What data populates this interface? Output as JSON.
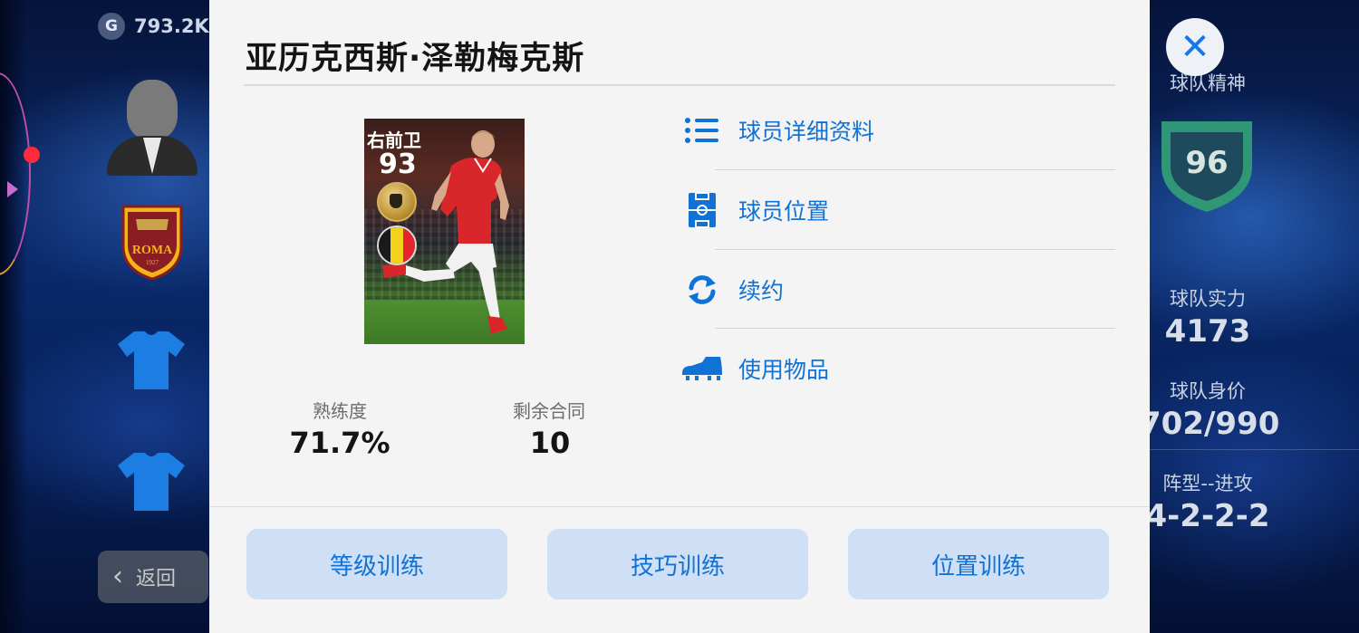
{
  "hud": {
    "coin_symbol": "G",
    "coins": "793.2K",
    "back_label": "返回"
  },
  "team_panel": {
    "spirit_label": "球队精神",
    "spirit_value": "96",
    "strength_label": "球队实力",
    "strength_value": "4173",
    "value_label": "球队身价",
    "value_value": "702/990",
    "formation_label": "阵型--进攻",
    "formation_value": "4-2-2-2"
  },
  "club_badge": {
    "name": "ROMA",
    "year": "1927"
  },
  "modal": {
    "player_name": "亚历克西斯·泽勒梅克斯",
    "card": {
      "position": "右前卫",
      "rating": "93",
      "flag_colors": [
        "#1a1a1a",
        "#f2d21c",
        "#e3242b"
      ]
    },
    "stats": [
      {
        "label": "熟练度",
        "value": "71.7%"
      },
      {
        "label": "剩余合同",
        "value": "10"
      }
    ],
    "menu": [
      {
        "label": "球员详细资料",
        "icon": "list-icon"
      },
      {
        "label": "球员位置",
        "icon": "pitch-icon"
      },
      {
        "label": "续约",
        "icon": "refresh-icon"
      },
      {
        "label": "使用物品",
        "icon": "boot-icon"
      }
    ],
    "actions": [
      {
        "label": "等级训练"
      },
      {
        "label": "技巧训练"
      },
      {
        "label": "位置训练"
      }
    ]
  },
  "colors": {
    "accent": "#1172d6",
    "button_bg": "#cfe0f6",
    "modal_bg": "#f4f4f5"
  }
}
